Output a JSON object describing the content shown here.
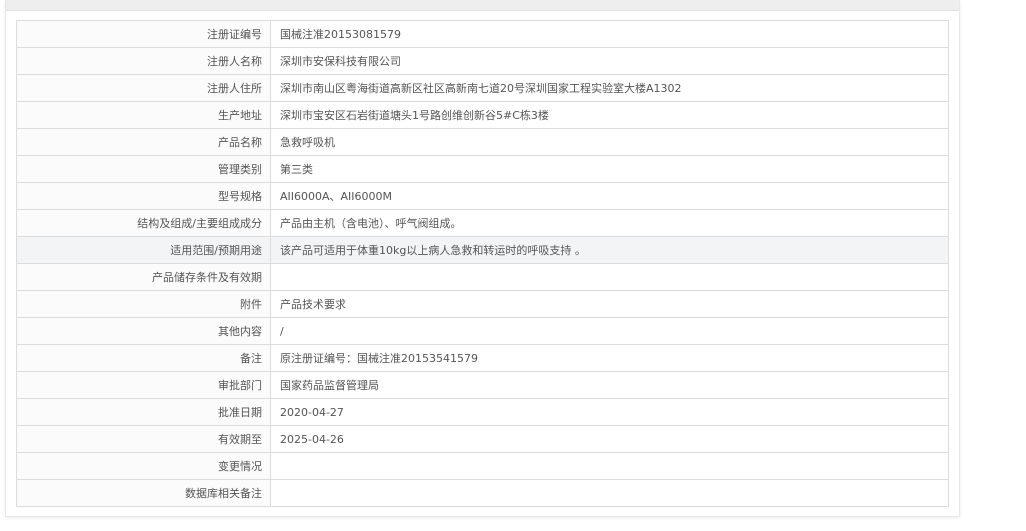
{
  "rows": [
    {
      "label": "注册证编号",
      "value": "国械注准20153081579"
    },
    {
      "label": "注册人名称",
      "value": "深圳市安保科技有限公司"
    },
    {
      "label": "注册人住所",
      "value": "深圳市南山区粤海街道高新区社区高新南七道20号深圳国家工程实验室大楼A1302"
    },
    {
      "label": "生产地址",
      "value": "深圳市宝安区石岩街道塘头1号路创维创新谷5#C栋3楼"
    },
    {
      "label": "产品名称",
      "value": "急救呼吸机"
    },
    {
      "label": "管理类别",
      "value": "第三类"
    },
    {
      "label": "型号规格",
      "value": "AII6000A、AII6000M"
    },
    {
      "label": "结构及组成/主要组成成分",
      "value": "产品由主机（含电池）、呼气阀组成。"
    },
    {
      "label": "适用范围/预期用途",
      "value": "该产品可适用于体重10kg以上病人急救和转运时的呼吸支持 。",
      "highlighted": true
    },
    {
      "label": "产品储存条件及有效期",
      "value": ""
    },
    {
      "label": "附件",
      "value": "产品技术要求"
    },
    {
      "label": "其他内容",
      "value": "/"
    },
    {
      "label": "备注",
      "value": "原注册证编号：国械注准20153541579"
    },
    {
      "label": "审批部门",
      "value": "国家药品监督管理局"
    },
    {
      "label": "批准日期",
      "value": "2020-04-27"
    },
    {
      "label": "有效期至",
      "value": "2025-04-26"
    },
    {
      "label": "变更情况",
      "value": ""
    },
    {
      "label": "数据库相关备注",
      "value": ""
    }
  ],
  "colors": {
    "text": "#555555",
    "border": "#dcdcdc",
    "header_strip": "#eeeeee",
    "highlight_row": "#f3f4f6"
  }
}
